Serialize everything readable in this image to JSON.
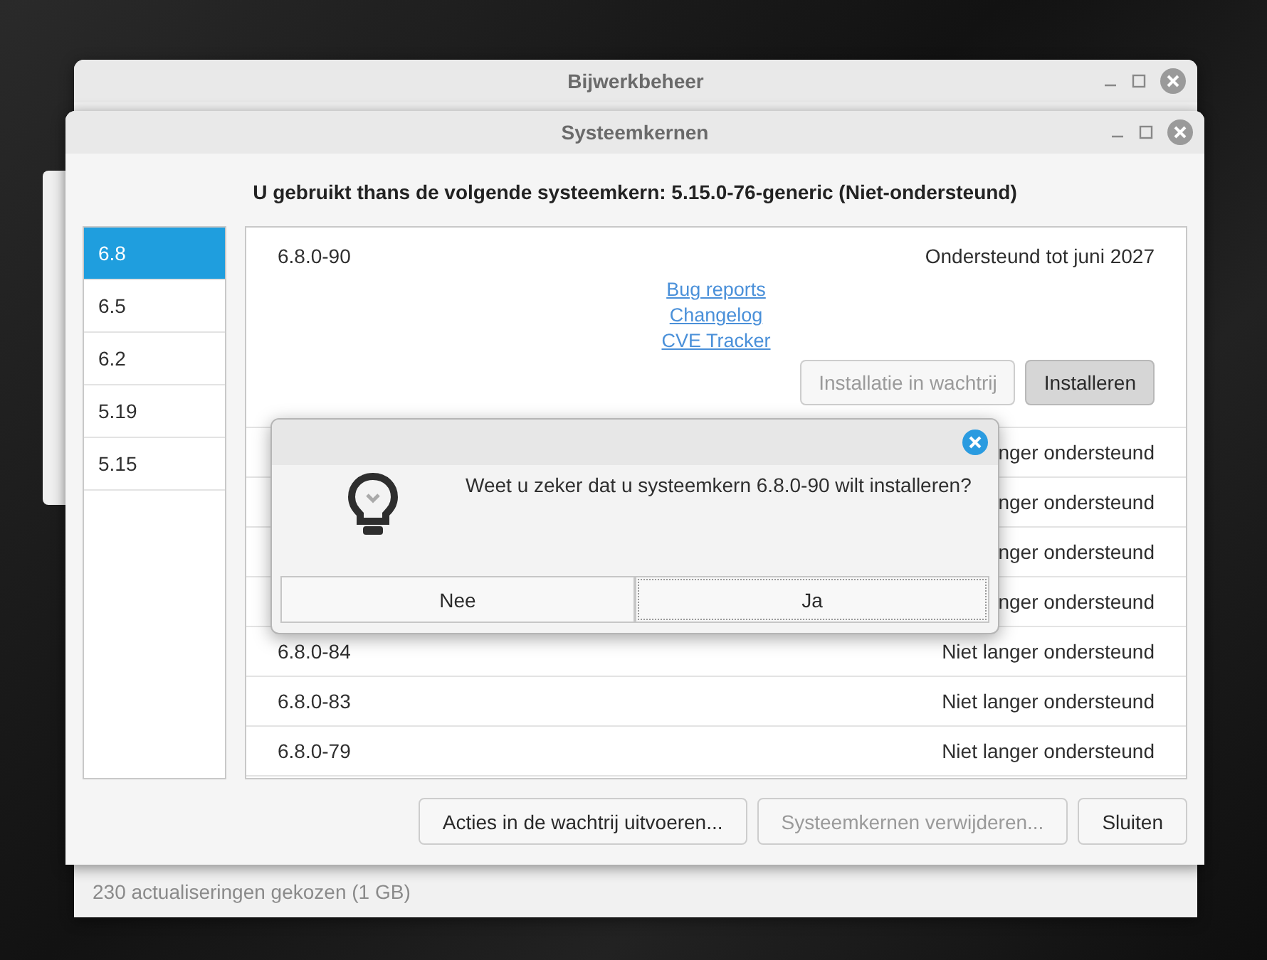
{
  "back_window": {
    "title": "Bijwerkbeheer",
    "status_bar": "230 actualiseringen gekozen (1 GB)"
  },
  "kernel_window": {
    "title": "Systeemkernen",
    "heading": "U gebruikt thans de volgende systeemkern: 5.15.0-76-generic (Niet-ondersteund)",
    "versions": [
      {
        "label": "6.8",
        "selected": true
      },
      {
        "label": "6.5",
        "selected": false
      },
      {
        "label": "6.2",
        "selected": false
      },
      {
        "label": "5.19",
        "selected": false
      },
      {
        "label": "5.15",
        "selected": false
      }
    ],
    "kernels": [
      {
        "version": "6.8.0-90",
        "status": "Ondersteund tot juni 2027",
        "expanded": true,
        "links": [
          "Bug reports",
          "Changelog",
          "CVE Tracker"
        ],
        "buttons": [
          {
            "label": "Installatie in wachtrij",
            "disabled": true,
            "hovered": false
          },
          {
            "label": "Installeren",
            "disabled": false,
            "hovered": true
          }
        ]
      },
      {
        "status": "nger ondersteund",
        "expanded": false
      },
      {
        "status": "nger ondersteund",
        "expanded": false
      },
      {
        "status": "nger ondersteund",
        "expanded": false
      },
      {
        "status": "nger ondersteund",
        "expanded": false
      },
      {
        "version": "6.8.0-84",
        "status": "Niet langer ondersteund",
        "expanded": false
      },
      {
        "version": "6.8.0-83",
        "status": "Niet langer ondersteund",
        "expanded": false
      },
      {
        "version": "6.8.0-79",
        "status": "Niet langer ondersteund",
        "expanded": false
      }
    ],
    "buttons": [
      {
        "label": "Acties in de wachtrij uitvoeren...",
        "disabled": false
      },
      {
        "label": "Systeemkernen verwijderen...",
        "disabled": true
      },
      {
        "label": "Sluiten",
        "disabled": false
      }
    ]
  },
  "dialog": {
    "message": "Weet u zeker dat u systeemkern 6.8.0-90 wilt installeren?",
    "buttons": [
      {
        "label": "Nee",
        "focused": false
      },
      {
        "label": "Ja",
        "focused": true
      }
    ]
  }
}
